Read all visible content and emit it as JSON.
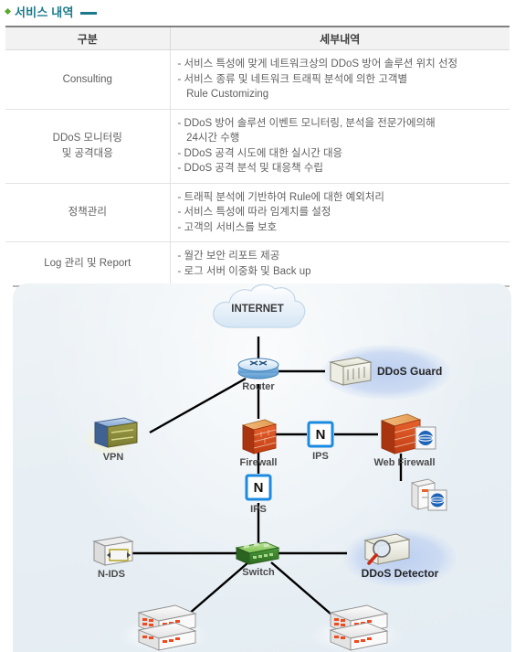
{
  "section": {
    "title": "서비스 내역",
    "bullet_color": "#5aa92a",
    "title_color": "#1a7a8c"
  },
  "table": {
    "headers": [
      "구분",
      "세부내역"
    ],
    "rows": [
      {
        "category": "Consulting",
        "details": [
          "- 서비스 특성에 맞게 네트워크상의 DDoS 방어 솔루션 위치 선정",
          "- 서비스 종류 및 네트워크 트래픽 분석에 의한 고객별",
          "   Rule Customizing"
        ]
      },
      {
        "category": "DDoS 모니터링\n및 공격대응",
        "details": [
          "- DDoS 방어 솔루션 이벤트 모니터링, 분석을 전문가에의해",
          "   24시간 수행",
          "- DDoS 공격 시도에 대한 실시간 대응",
          "- DDoS 공격 분석 및 대응책 수립"
        ]
      },
      {
        "category": "정책관리",
        "details": [
          "- 트래픽 분석에 기반하여 Rule에 대한 예외처리",
          "- 서비스 특성에 따라 임계치를 설정",
          "- 고객의 서비스를 보호"
        ]
      },
      {
        "category": "Log 관리 및 Report",
        "details": [
          "- 월간 보안 리포트 제공",
          "- 로그 서버 이중화 및 Back up"
        ]
      }
    ]
  },
  "diagram": {
    "background_color": "#e8eff4",
    "link_color": "#000000",
    "highlight_color": "#c5d4ef",
    "nodes": {
      "internet": "INTERNET",
      "router": "Router",
      "ddos_guard": "DDoS Guard",
      "vpn": "VPN",
      "firewall": "Firewall",
      "ips_top": "IPS",
      "ips_top_letter": "N",
      "web_firewall": "Web Firewall",
      "ips_mid": "IPS",
      "ips_mid_letter": "N",
      "nids": "N-IDS",
      "switch": "Switch",
      "ddos_detector": "DDoS Detector"
    }
  }
}
